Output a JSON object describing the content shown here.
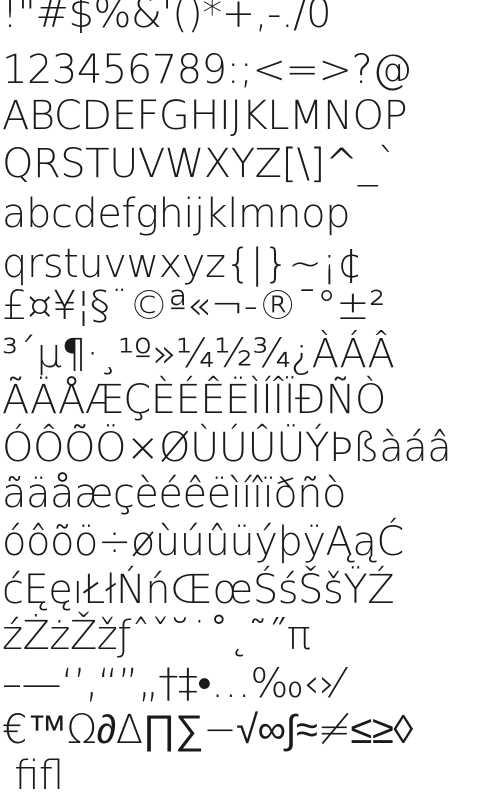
{
  "glyph_lines": [
    "!\"#$%&'()*+,-./0",
    "123456789:;<=>?@",
    "ABCDEFGHIJKLMNOP",
    "QRSTUVWXYZ[\\]^_`",
    "abcdefghijklmnop",
    "qrstuvwxyz{|}~¡¢",
    "£¤¥¦§¨©ª«¬-®¯°±²",
    "³´µ¶·¸¹º»¼½¾¿ÀÁÂ",
    "ÃÄÅÆÇÈÉÊËÌÍÎÏÐÑÒ",
    "ÓÔÕÖ×ØÙÚÛÜÝÞßàáâ",
    "ãäåæçèéêëìíîïðñò",
    "óôõö÷øùúûüýþÿĄąĆ",
    "ćĘęıŁłŃńŒœŚśŠšŸŹ",
    "źŻżŽžƒˆˇ˘˙˚˛˜˝π",
    "–—‘’‚“”„†‡•…‰‹›⁄",
    "€™Ω∂∆∏∑−√∞∫≈≠≤≥◊",
    " ﬁﬂ"
  ]
}
